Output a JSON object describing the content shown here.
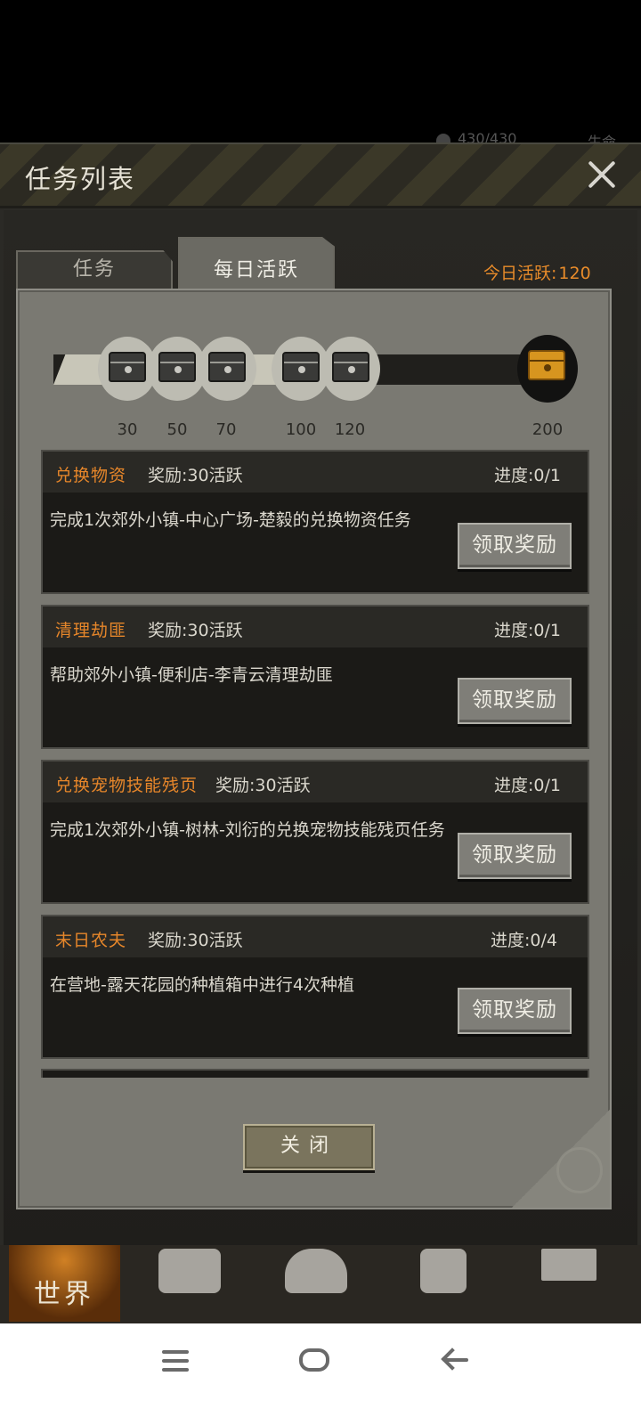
{
  "status_behind": {
    "hp": "430/430",
    "life_label": "生命"
  },
  "dialog": {
    "title": "任务列表",
    "close_icon": "close-icon"
  },
  "tabs": [
    {
      "label": "任务",
      "active": false
    },
    {
      "label": "每日活跃",
      "active": true
    }
  ],
  "daily_activity": {
    "label": "今日活跃",
    "value": "120"
  },
  "milestones": [
    {
      "value": "30",
      "reached": true
    },
    {
      "value": "50",
      "reached": true
    },
    {
      "value": "70",
      "reached": true
    },
    {
      "value": "100",
      "reached": true
    },
    {
      "value": "120",
      "reached": true
    },
    {
      "value": "200",
      "reached": false
    }
  ],
  "progress": {
    "current": 120,
    "max": 200
  },
  "tasks": [
    {
      "name": "兑换物资",
      "reward": "奖励:30活跃",
      "progress": "进度:0/1",
      "description": "完成1次郊外小镇-中心广场-楚毅的兑换物资任务",
      "button": "领取奖励"
    },
    {
      "name": "清理劫匪",
      "reward": "奖励:30活跃",
      "progress": "进度:0/1",
      "description": "帮助郊外小镇-便利店-李青云清理劫匪",
      "button": "领取奖励"
    },
    {
      "name": "兑换宠物技能残页",
      "reward": "奖励:30活跃",
      "progress": "进度:0/1",
      "description": "完成1次郊外小镇-树林-刘衍的兑换宠物技能残页任务",
      "button": "领取奖励"
    },
    {
      "name": "末日农夫",
      "reward": "奖励:30活跃",
      "progress": "进度:0/4",
      "description": "在营地-露天花园的种植箱中进行4次种植",
      "button": "领取奖励"
    }
  ],
  "close_button": "关闭",
  "game_nav": {
    "world_label": "世界"
  },
  "colors": {
    "accent_orange": "#e6862a",
    "panel": "#7a7972",
    "card": "#1b1a17"
  }
}
